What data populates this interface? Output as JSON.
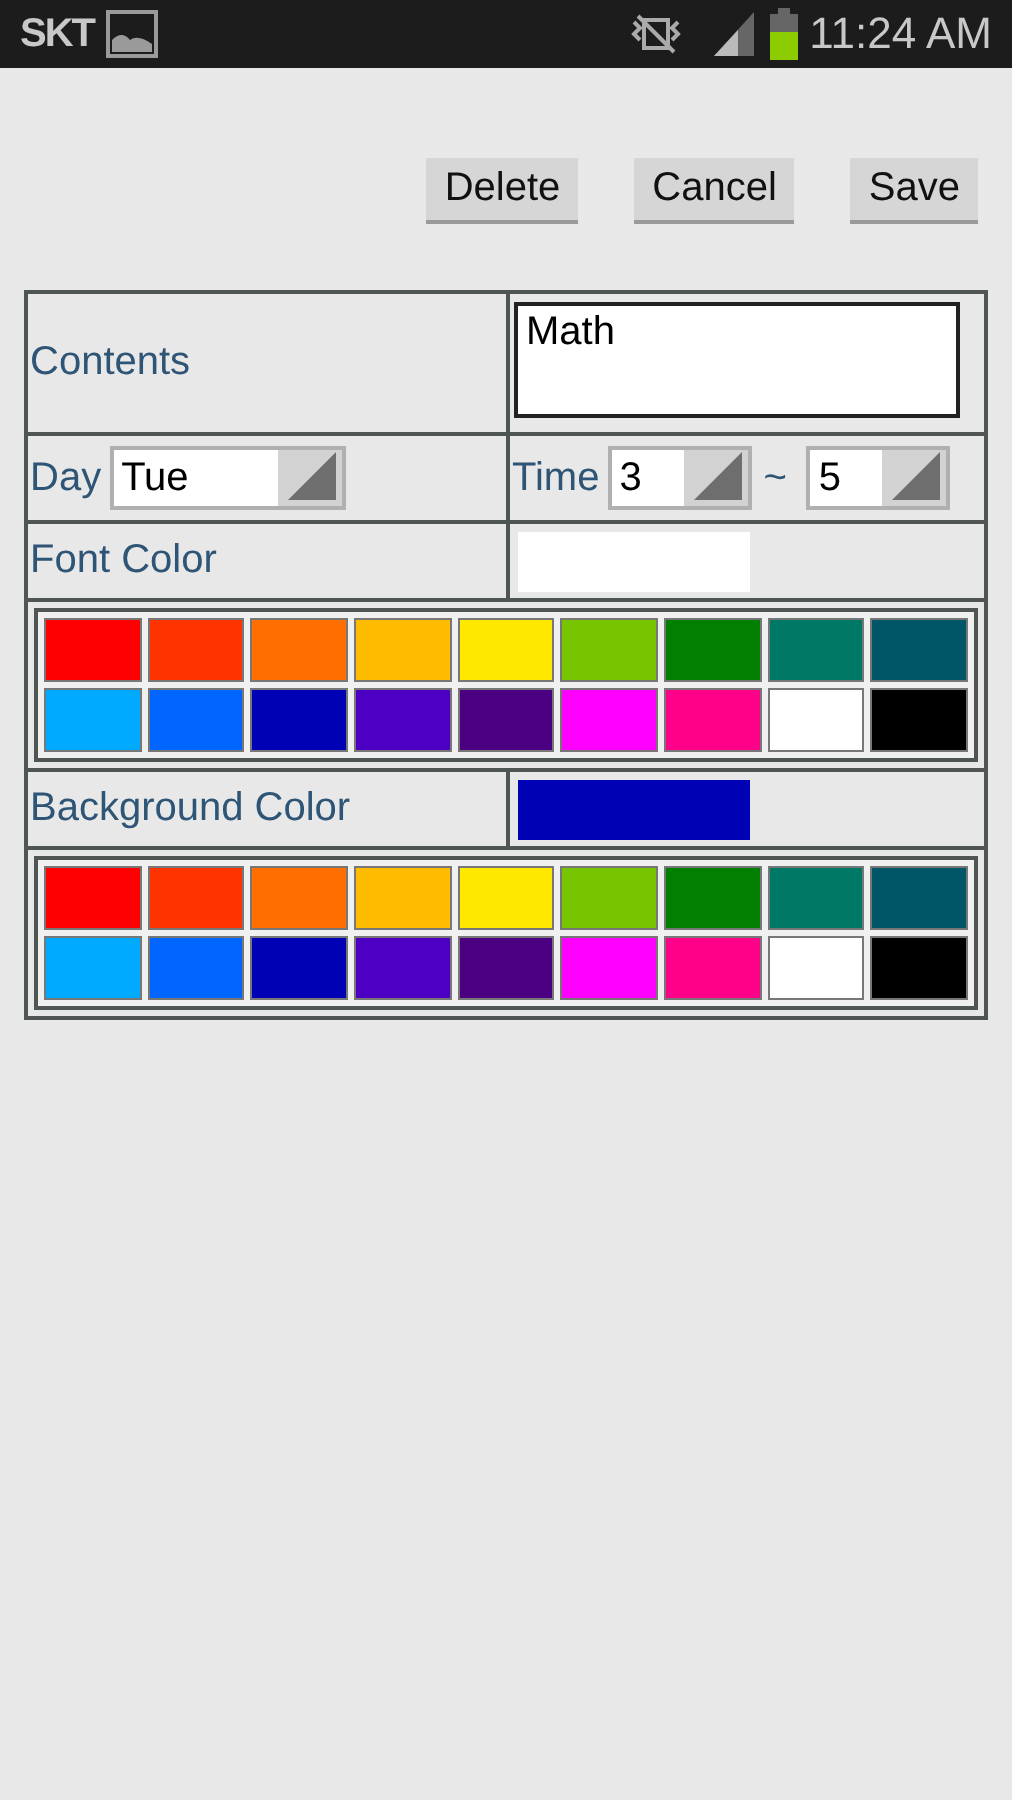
{
  "status_bar": {
    "carrier": "SKT",
    "time": "11:24 AM"
  },
  "buttons": [
    "Delete",
    "Cancel",
    "Save"
  ],
  "contents": {
    "label": "Contents",
    "value": "Math"
  },
  "day": {
    "label": "Day",
    "value": "Tue"
  },
  "time": {
    "label": "Time",
    "from": "3",
    "separator": "~",
    "to": "5"
  },
  "font_color": {
    "label": "Font Color",
    "color": "#ffffff",
    "palette": [
      {
        "color": "#ff0000"
      },
      {
        "color": "#ff3300"
      },
      {
        "color": "#ff6e00"
      },
      {
        "color": "#ffbb00"
      },
      {
        "color": "#ffe800"
      },
      {
        "color": "#77c500"
      },
      {
        "color": "#007f00"
      },
      {
        "color": "#007866"
      },
      {
        "color": "#005566"
      },
      {
        "color": "#00aaff"
      },
      {
        "color": "#0066ff"
      },
      {
        "color": "#0000b4"
      },
      {
        "color": "#4d00c4"
      },
      {
        "color": "#4a0080"
      },
      {
        "color": "#ff00ff"
      },
      {
        "color": "#ff0088"
      },
      {
        "color": "#ffffff"
      },
      {
        "color": "#000000"
      }
    ]
  },
  "background_color": {
    "label": "Background Color",
    "color": "#0000b4",
    "palette": [
      {
        "color": "#ff0000"
      },
      {
        "color": "#ff3300"
      },
      {
        "color": "#ff6e00"
      },
      {
        "color": "#ffbb00"
      },
      {
        "color": "#ffe800"
      },
      {
        "color": "#77c500"
      },
      {
        "color": "#007f00"
      },
      {
        "color": "#007866"
      },
      {
        "color": "#005566"
      },
      {
        "color": "#00aaff"
      },
      {
        "color": "#0066ff"
      },
      {
        "color": "#0000b4"
      },
      {
        "color": "#4d00c4"
      },
      {
        "color": "#4a0080"
      },
      {
        "color": "#ff00ff"
      },
      {
        "color": "#ff0088"
      },
      {
        "color": "#ffffff"
      },
      {
        "color": "#000000"
      }
    ]
  }
}
